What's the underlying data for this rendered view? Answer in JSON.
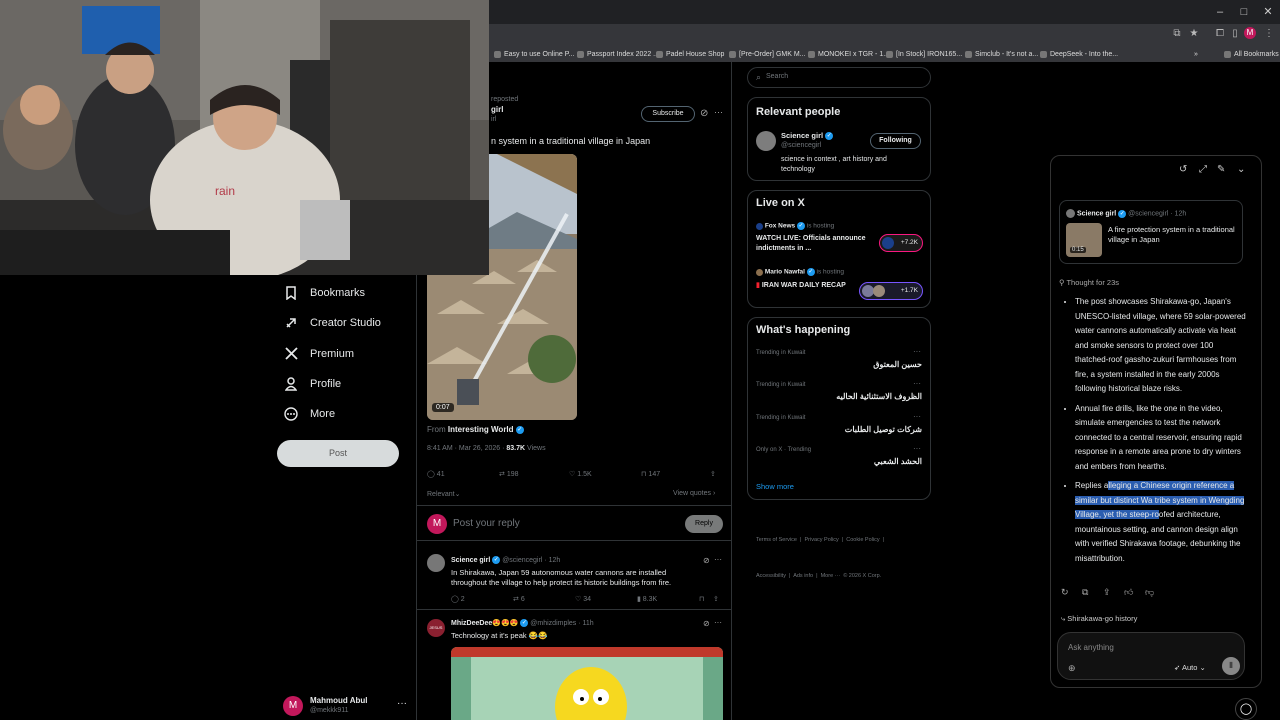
{
  "browser": {
    "bookmarks": [
      {
        "label": "Easy to use Online P..."
      },
      {
        "label": "Passport Index 2022 ..."
      },
      {
        "label": "Padel House Shop"
      },
      {
        "label": "[Pre-Order] GMK M..."
      },
      {
        "label": "MONOKEI x TGR - 1..."
      },
      {
        "label": "[In Stock] IRON165..."
      },
      {
        "label": "Simclub - It's not a..."
      },
      {
        "label": "DeepSeek - Into the..."
      }
    ],
    "all_bookmarks": "All Bookmarks",
    "profile_initial": "M",
    "colors": {
      "chrome_bg": "#202124",
      "toolbar_bg": "#35363a",
      "accent": "#1d9bf0"
    }
  },
  "left_nav": {
    "items": [
      {
        "label": "Bookmarks",
        "icon": "bookmark-icon"
      },
      {
        "label": "Creator Studio",
        "icon": "rocket-icon"
      },
      {
        "label": "Premium",
        "icon": "x-logo-icon"
      },
      {
        "label": "Profile",
        "icon": "person-icon"
      },
      {
        "label": "More",
        "icon": "more-circle-icon"
      }
    ],
    "post_button": "Post",
    "account": {
      "name": "Mahmoud Abul",
      "handle": "@mekkk911",
      "initial": "M"
    }
  },
  "tweet": {
    "reposted": "reposted",
    "author_partial": "girl",
    "handle_partial": "irl",
    "subscribe": "Subscribe",
    "text_partial": "n system in a traditional village in Japan",
    "video_duration": "0:07",
    "from_label": "From",
    "from_account": "Interesting World",
    "time": "8:41 AM · Mar 26, 2026 ·",
    "views_count": "83.7K",
    "views_label": "Views",
    "stats": {
      "replies": "41",
      "reposts": "198",
      "likes": "1.5K",
      "bookmarks": "147"
    },
    "relevant": "Relevant",
    "view_quotes": "View quotes",
    "reply_placeholder": "Post your reply",
    "reply_button": "Reply",
    "reply_avatar": "M"
  },
  "replies": [
    {
      "name": "Science girl",
      "handle": "@sciencegirl · 12h",
      "text": "In Shirakawa, Japan 59 autonomous water cannons are installed throughout the village to help protect its historic buildings from fire.",
      "stats": {
        "replies": "2",
        "reposts": "6",
        "likes": "34",
        "views": "8.3K"
      }
    },
    {
      "name": "MhizDeeDee😍😍😍",
      "handle": "@mhizdimples · 11h",
      "text": "Technology at it's peak 😂😂",
      "avatar_text": "JESUS"
    }
  ],
  "right": {
    "search_placeholder": "Search",
    "relevant_people": {
      "title": "Relevant people",
      "name": "Science girl",
      "handle": "@sciencegirl",
      "bio": "science in context , art history and technology",
      "follow_state": "Following"
    },
    "live": {
      "title": "Live on X",
      "items": [
        {
          "host": "Fox News",
          "status": "is hosting",
          "title": "WATCH LIVE: Officials announce indictments in ...",
          "count": "+7.2K"
        },
        {
          "host": "Mario Nawfal",
          "status": "is hosting",
          "title": "IRAN WAR DAILY RECAP",
          "count": "+1.7K"
        }
      ]
    },
    "happening": {
      "title": "What's happening",
      "items": [
        {
          "context": "Trending in Kuwait",
          "topic": "حسين المعتوق"
        },
        {
          "context": "Trending in Kuwait",
          "topic": "الظروف الاستثنائية الحاليه"
        },
        {
          "context": "Trending in Kuwait",
          "topic": "شركات توصيل الطلبات"
        },
        {
          "context": "Only on X · Trending",
          "topic": "الحشد الشعبي"
        }
      ],
      "show_more": "Show more"
    },
    "footer": {
      "line1": "Terms of Service  |  Privacy Policy  |  Cookie Policy  |",
      "line2": "Accessibility  |  Ads info  |  More ···  © 2026 X Corp."
    }
  },
  "grok": {
    "quoted": {
      "name": "Science girl",
      "handle": "@sciencegirl · 12h",
      "text": "A fire protection system in a traditional village in Japan",
      "duration": "0:15"
    },
    "thought": "Thought for 23s",
    "bullets": [
      "The post showcases Shirakawa-go, Japan's UNESCO-listed village, where 59 solar-powered water cannons automatically activate via heat and smoke sensors to protect over 100 thatched-roof gassho-zukuri farmhouses from fire, a system installed in the early 2000s following historical blaze risks.",
      "Annual fire drills, like the one in the video, simulate emergencies to test the network connected to a central reservoir, ensuring rapid response in a remote area prone to dry winters and embers from hearths."
    ],
    "bullet3_plain": "Replies a",
    "bullet3_highlight": "lleging a Chinese origin reference a similar but distinct Wa tribe system in Wengding Village, yet the steep-ro",
    "bullet3_rest": "ofed architecture, mountainous setting, and cannon design align with verified Shirakawa footage, debunking the misattribution.",
    "suggestion": "Shirakawa-go history",
    "input_placeholder": "Ask anything",
    "mode": "Auto"
  }
}
